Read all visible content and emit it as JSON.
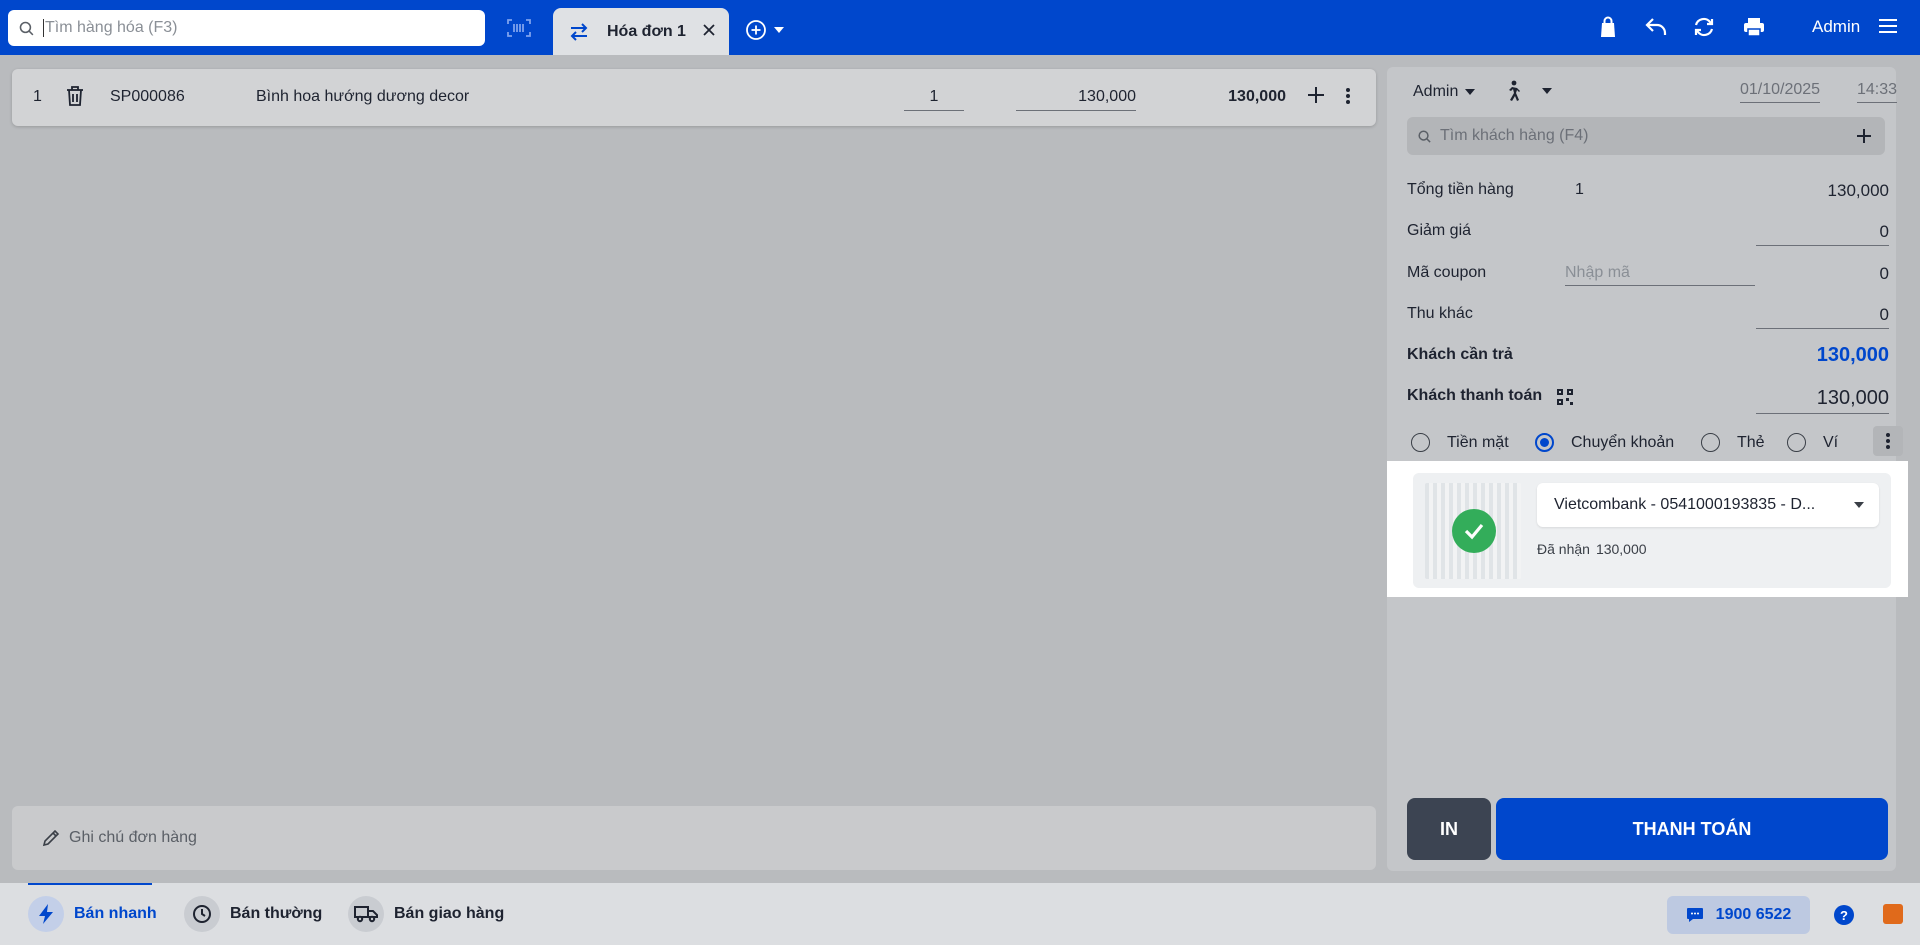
{
  "header": {
    "search_placeholder": "Tìm hàng hóa (F3)",
    "tab_label": "Hóa đơn 1",
    "user": "Admin"
  },
  "item": {
    "index": "1",
    "code": "SP000086",
    "name": "Bình hoa hướng dương decor",
    "quantity": "1",
    "unit_price": "130,000",
    "line_total": "130,000"
  },
  "order_note_placeholder": "Ghi chú đơn hàng",
  "panel": {
    "seller": "Admin",
    "date": "01/10/2025",
    "time": "14:33",
    "customer_search_placeholder": "Tìm khách hàng (F4)",
    "subtotal_label": "Tổng tiền hàng",
    "subtotal_count": "1",
    "subtotal_value": "130,000",
    "discount_label": "Giảm giá",
    "discount_value": "0",
    "coupon_label": "Mã coupon",
    "coupon_placeholder": "Nhập mã",
    "coupon_value": "0",
    "other_label": "Thu khác",
    "other_value": "0",
    "due_label": "Khách cần trả",
    "due_value": "130,000",
    "paid_label": "Khách thanh toán",
    "paid_value": "130,000",
    "methods": [
      "Tiền mặt",
      "Chuyển khoản",
      "Thẻ",
      "Ví"
    ],
    "selected_method": "Chuyển khoản",
    "bank_account": "Vietcombank - 0541000193835 - D...",
    "received_label": "Đã nhận",
    "received_value": "130,000",
    "print_button": "IN",
    "pay_button": "THANH TOÁN"
  },
  "footer": {
    "modes": [
      "Bán nhanh",
      "Bán thường",
      "Bán giao hàng"
    ],
    "active_mode": "Bán nhanh",
    "hotline": "1900 6522"
  },
  "colors": {
    "brand_blue": "#0047cc",
    "success_green": "#1fa64a"
  }
}
